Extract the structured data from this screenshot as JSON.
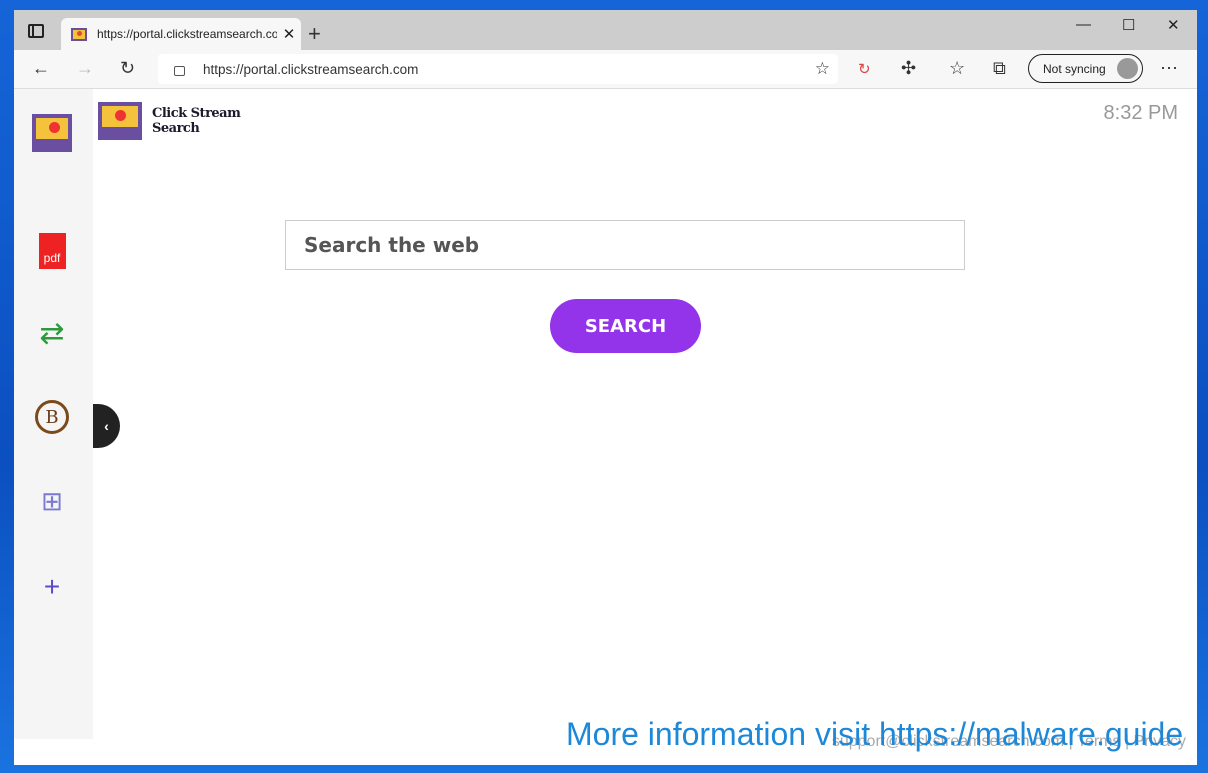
{
  "browser": {
    "tab_title": "https://portal.clickstreamsearch.com",
    "url": "https://portal.clickstreamsearch.com",
    "sync_label": "Not syncing"
  },
  "page": {
    "logo_line1": "Click Stream",
    "logo_line2": "Search",
    "time": "8:32 PM",
    "search_placeholder": "Search the web",
    "search_button": "SEARCH"
  },
  "sidebar": {
    "items": [
      "pdf-app",
      "sync-app",
      "bitcoin-app",
      "calculator-app",
      "add"
    ]
  },
  "footer": {
    "email": "support@clickstreamsearch.com",
    "terms": "Terms",
    "privacy": "Privacy"
  },
  "watermark": "More information visit https://malware.guide",
  "colors": {
    "accent": "#9333ea",
    "watermark": "#1e88d8"
  }
}
